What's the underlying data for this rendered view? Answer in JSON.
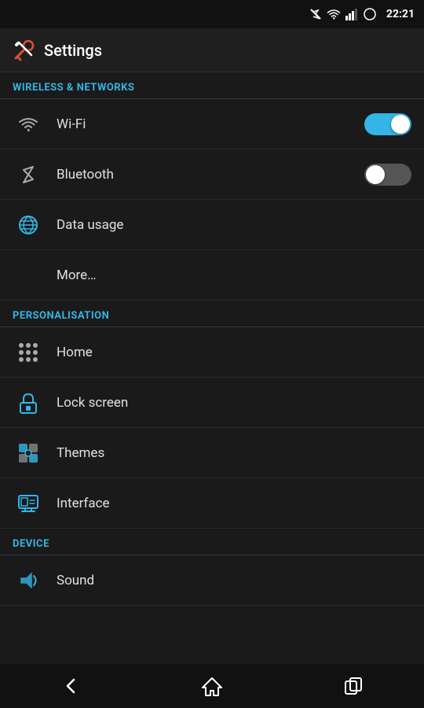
{
  "statusBar": {
    "time": "22:21"
  },
  "titleBar": {
    "title": "Settings"
  },
  "sections": [
    {
      "id": "wireless",
      "header": "WIRELESS & NETWORKS",
      "items": [
        {
          "id": "wifi",
          "label": "Wi-Fi",
          "icon": "wifi",
          "toggle": true,
          "toggleState": "on"
        },
        {
          "id": "bluetooth",
          "label": "Bluetooth",
          "icon": "bluetooth",
          "toggle": true,
          "toggleState": "off"
        },
        {
          "id": "data-usage",
          "label": "Data usage",
          "icon": "data",
          "toggle": false
        },
        {
          "id": "more",
          "label": "More…",
          "icon": "none",
          "toggle": false
        }
      ]
    },
    {
      "id": "personalisation",
      "header": "PERSONALISATION",
      "items": [
        {
          "id": "home",
          "label": "Home",
          "icon": "grid",
          "toggle": false
        },
        {
          "id": "lock-screen",
          "label": "Lock screen",
          "icon": "lock",
          "toggle": false
        },
        {
          "id": "themes",
          "label": "Themes",
          "icon": "themes",
          "toggle": false
        },
        {
          "id": "interface",
          "label": "Interface",
          "icon": "interface",
          "toggle": false
        }
      ]
    },
    {
      "id": "device",
      "header": "DEVICE",
      "items": [
        {
          "id": "sound",
          "label": "Sound",
          "icon": "sound",
          "toggle": false
        }
      ]
    }
  ],
  "navBar": {
    "back": "back",
    "home": "home",
    "recents": "recents"
  }
}
